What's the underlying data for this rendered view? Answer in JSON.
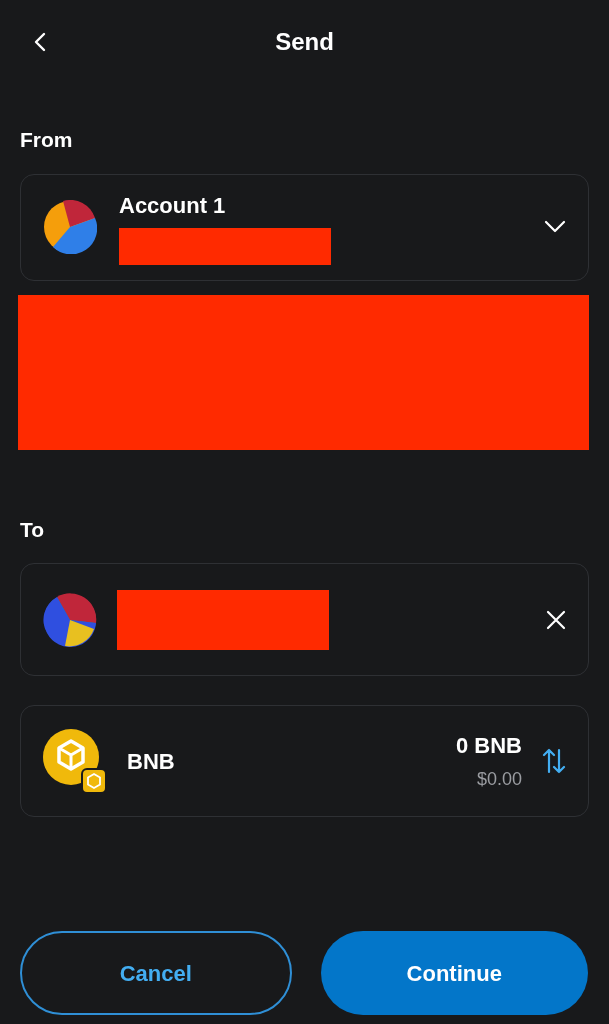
{
  "header": {
    "title": "Send"
  },
  "from": {
    "label": "From",
    "account_name": "Account 1"
  },
  "to": {
    "label": "To"
  },
  "asset": {
    "symbol": "BNB",
    "amount": "0 BNB",
    "fiat": "$0.00"
  },
  "buttons": [
    {
      "label": "Cancel",
      "kind": "secondary"
    },
    {
      "label": "Continue",
      "kind": "primary"
    }
  ]
}
